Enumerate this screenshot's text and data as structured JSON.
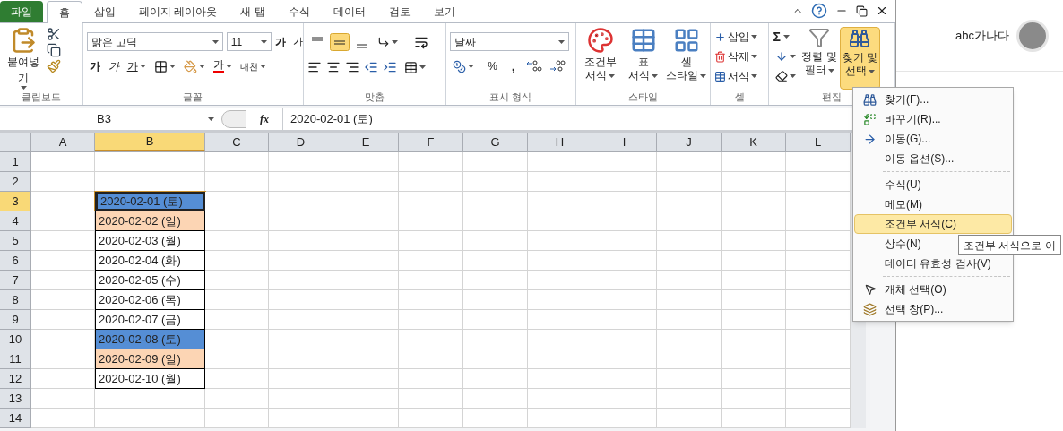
{
  "tabs": [
    {
      "label": "파일",
      "kind": "file",
      "selected": false
    },
    {
      "label": "홈",
      "kind": "tab",
      "selected": true
    },
    {
      "label": "삽입",
      "kind": "tab",
      "selected": false
    },
    {
      "label": "페이지 레이아웃",
      "kind": "tab",
      "selected": false
    },
    {
      "label": "새 탭",
      "kind": "tab",
      "selected": false
    },
    {
      "label": "수식",
      "kind": "tab",
      "selected": false
    },
    {
      "label": "데이터",
      "kind": "tab",
      "selected": false
    },
    {
      "label": "검토",
      "kind": "tab",
      "selected": false
    },
    {
      "label": "보기",
      "kind": "tab",
      "selected": false
    }
  ],
  "ribbon": {
    "clipboard": {
      "label": "클립보드",
      "paste": "붙여넣기"
    },
    "font": {
      "label": "글꼴",
      "font_name": "맑은 고딕",
      "font_size": "11",
      "grow": "가",
      "shrink": "가",
      "bold": "가",
      "italic": "가",
      "underline": "가",
      "font_color": "가",
      "phonetic": "내천"
    },
    "alignment": {
      "label": "맞춤",
      "middle_align_selected": true
    },
    "number": {
      "label": "표시 형식",
      "format": "날짜",
      "percent": "%",
      "comma": ","
    },
    "styles": {
      "label": "스타일",
      "buttons": [
        {
          "lines": [
            "조건부",
            "서식"
          ],
          "kind": "conditional"
        },
        {
          "lines": [
            "표",
            "서식"
          ],
          "kind": "table"
        },
        {
          "lines": [
            "셀",
            "스타일"
          ],
          "kind": "cell"
        }
      ]
    },
    "cells": {
      "label": "셀",
      "buttons": [
        {
          "label": "삽입",
          "kind": "insert"
        },
        {
          "label": "삭제",
          "kind": "delete"
        },
        {
          "label": "서식",
          "kind": "format"
        }
      ]
    },
    "editing": {
      "label": "편집",
      "sigma": "Σ",
      "sort": [
        "정렬 및",
        "필터"
      ],
      "find": {
        "lines": [
          "찾기 및",
          "선택"
        ],
        "selected": true
      }
    }
  },
  "formula_bar": {
    "name_box": "B3",
    "fx": "fx",
    "value": "2020-02-01 (토)"
  },
  "grid": {
    "columns": [
      {
        "label": "A",
        "selected": false
      },
      {
        "label": "B",
        "selected": true
      },
      {
        "label": "C",
        "selected": false
      },
      {
        "label": "D",
        "selected": false
      },
      {
        "label": "E",
        "selected": false
      },
      {
        "label": "F",
        "selected": false
      },
      {
        "label": "G",
        "selected": false
      },
      {
        "label": "H",
        "selected": false
      },
      {
        "label": "I",
        "selected": false
      },
      {
        "label": "J",
        "selected": false
      },
      {
        "label": "K",
        "selected": false
      },
      {
        "label": "L",
        "selected": false
      }
    ],
    "rows": [
      {
        "label": "1",
        "selected": false
      },
      {
        "label": "2",
        "selected": false
      },
      {
        "label": "3",
        "selected": true,
        "cell_b": {
          "text": "2020-02-01 (토)",
          "color": "#558ed5",
          "selected": true
        }
      },
      {
        "label": "4",
        "selected": false,
        "cell_b": {
          "text": "2020-02-02 (일)",
          "color": "#fcd5b4",
          "selected": false
        }
      },
      {
        "label": "5",
        "selected": false,
        "cell_b": {
          "text": "2020-02-03 (월)",
          "color": "#ffffff",
          "selected": false
        }
      },
      {
        "label": "6",
        "selected": false,
        "cell_b": {
          "text": "2020-02-04 (화)",
          "color": "#ffffff",
          "selected": false
        }
      },
      {
        "label": "7",
        "selected": false,
        "cell_b": {
          "text": "2020-02-05 (수)",
          "color": "#ffffff",
          "selected": false
        }
      },
      {
        "label": "8",
        "selected": false,
        "cell_b": {
          "text": "2020-02-06 (목)",
          "color": "#ffffff",
          "selected": false
        }
      },
      {
        "label": "9",
        "selected": false,
        "cell_b": {
          "text": "2020-02-07 (금)",
          "color": "#ffffff",
          "selected": false
        }
      },
      {
        "label": "10",
        "selected": false,
        "cell_b": {
          "text": "2020-02-08 (토)",
          "color": "#558ed5",
          "selected": false
        }
      },
      {
        "label": "11",
        "selected": false,
        "cell_b": {
          "text": "2020-02-09 (일)",
          "color": "#fcd5b4",
          "selected": false
        }
      },
      {
        "label": "12",
        "selected": false,
        "cell_b": {
          "text": "2020-02-10 (월)",
          "color": "#ffffff",
          "selected": false
        }
      },
      {
        "label": "13",
        "selected": false
      },
      {
        "label": "14",
        "selected": false
      }
    ]
  },
  "menu": [
    {
      "kind": "find",
      "label": "찾기(F)...",
      "selected": false
    },
    {
      "kind": "replace",
      "label": "바꾸기(R)...",
      "selected": false
    },
    {
      "kind": "goto",
      "label": "이동(G)...",
      "selected": false
    },
    {
      "kind": "plain",
      "label": "이동 옵션(S)...",
      "selected": false
    },
    {
      "kind": "separator"
    },
    {
      "kind": "plain",
      "label": "수식(U)",
      "selected": false
    },
    {
      "kind": "plain",
      "label": "메모(M)",
      "selected": false
    },
    {
      "kind": "plain",
      "label": "조건부 서식(C)",
      "selected": true
    },
    {
      "kind": "plain",
      "label": "상수(N)",
      "selected": false
    },
    {
      "kind": "plain",
      "label": "데이터 유효성 검사(V)",
      "selected": false
    },
    {
      "kind": "separator"
    },
    {
      "kind": "pointer",
      "label": "개체 선택(O)",
      "selected": false
    },
    {
      "kind": "pane",
      "label": "선택 창(P)...",
      "selected": false
    }
  ],
  "tooltip": "조건부 서식으로 이",
  "account": {
    "name": "abc가나다"
  }
}
